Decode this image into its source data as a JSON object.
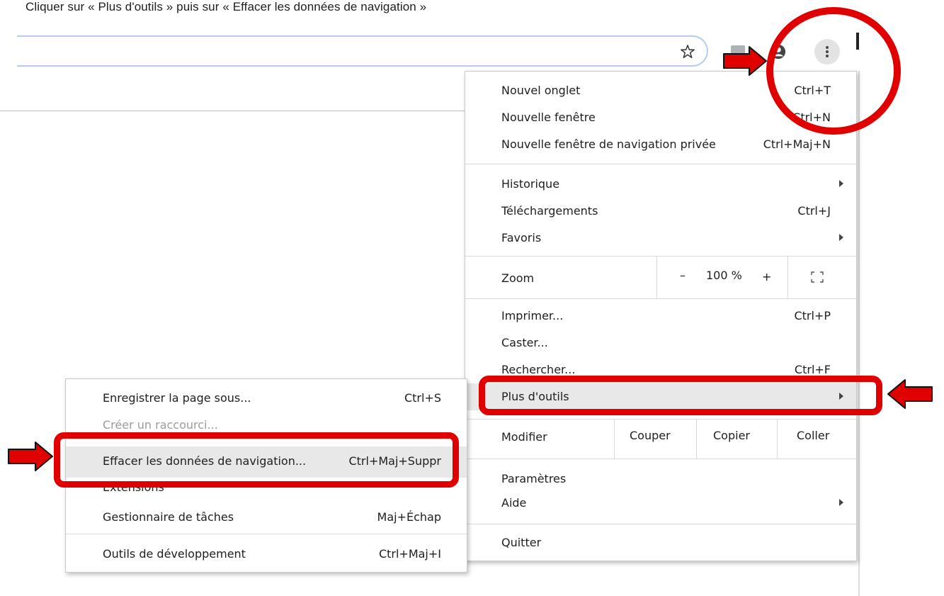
{
  "instruction": "Cliquer sur « Plus d'outils » puis sur « Effacer les données de navigation »",
  "icons": {
    "star": "star-icon",
    "extension": "extension-icon",
    "profile": "profile-icon",
    "menu": "three-dots-vertical-icon",
    "submenu_arrow": "chevron-right-icon",
    "fullscreen": "fullscreen-icon",
    "annotation_arrow": "red-arrow-icon"
  },
  "colors": {
    "annotation": "#e00000",
    "highlight": "#e8e8e8",
    "omnibox_border": "#b3cdf1"
  },
  "main_menu": {
    "new_tab": {
      "label": "Nouvel onglet",
      "shortcut": "Ctrl+T"
    },
    "new_window": {
      "label": "Nouvelle fenêtre",
      "shortcut": "Ctrl+N"
    },
    "incognito": {
      "label": "Nouvelle fenêtre de navigation privée",
      "shortcut": "Ctrl+Maj+N"
    },
    "history": {
      "label": "Historique"
    },
    "downloads": {
      "label": "Téléchargements",
      "shortcut": "Ctrl+J"
    },
    "bookmarks": {
      "label": "Favoris"
    },
    "zoom": {
      "label": "Zoom",
      "minus": "–",
      "value": "100 %",
      "plus": "+"
    },
    "print": {
      "label": "Imprimer...",
      "shortcut": "Ctrl+P"
    },
    "cast": {
      "label": "Caster..."
    },
    "find": {
      "label": "Rechercher...",
      "shortcut": "Ctrl+F"
    },
    "more_tools": {
      "label": "Plus d'outils"
    },
    "edit": {
      "label": "Modifier",
      "cut": "Couper",
      "copy": "Copier",
      "paste": "Coller"
    },
    "settings": {
      "label": "Paramètres"
    },
    "help": {
      "label": "Aide"
    },
    "quit": {
      "label": "Quitter"
    }
  },
  "sub_menu": {
    "save_page": {
      "label": "Enregistrer la page sous...",
      "shortcut": "Ctrl+S"
    },
    "create_shortcut": {
      "label": "Créer un raccourci..."
    },
    "clear_data": {
      "label": "Effacer les données de navigation...",
      "shortcut": "Ctrl+Maj+Suppr"
    },
    "extensions": {
      "label": "Extensions"
    },
    "task_manager": {
      "label": "Gestionnaire de tâches",
      "shortcut": "Maj+Échap"
    },
    "dev_tools": {
      "label": "Outils de développement",
      "shortcut": "Ctrl+Maj+I"
    }
  }
}
